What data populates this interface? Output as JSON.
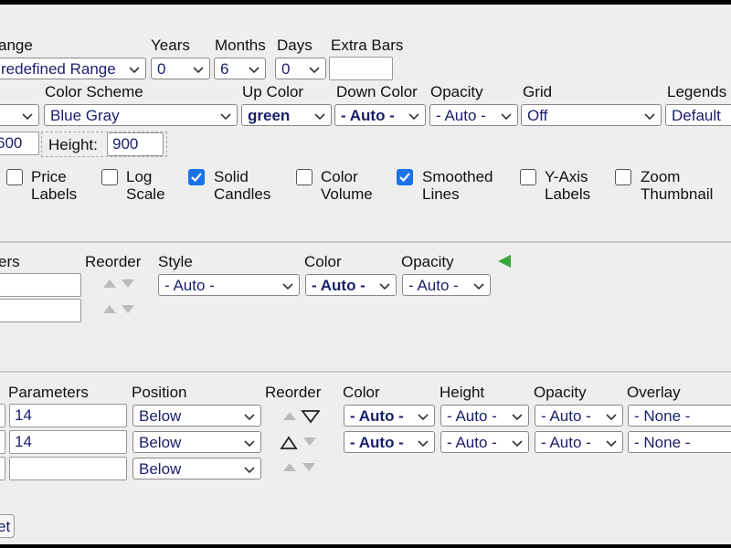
{
  "range": {
    "label_range": "ange",
    "label_years": "Years",
    "label_months": "Months",
    "label_days": "Days",
    "label_extra_bars": "Extra Bars",
    "range_value": "redefined Range",
    "years_value": "0",
    "months_value": "6",
    "days_value": "0",
    "extra_bars_value": ""
  },
  "appearance": {
    "label_color_scheme": "Color Scheme",
    "label_up_color": "Up Color",
    "label_down_color": "Down Color",
    "label_opacity": "Opacity",
    "label_grid": "Grid",
    "label_legends": "Legends",
    "color_scheme_value": "Blue Gray",
    "up_color_value": "green",
    "down_color_value": "- Auto -",
    "opacity_value": "- Auto -",
    "grid_value": "Off",
    "legends_value": "Default",
    "width_value": "600",
    "label_height": "Height:",
    "height_value": "900"
  },
  "options": [
    {
      "label": "Price\nLabels",
      "checked": false
    },
    {
      "label": "Log\nScale",
      "checked": false
    },
    {
      "label": "Solid\nCandles",
      "checked": true
    },
    {
      "label": "Color\nVolume",
      "checked": false
    },
    {
      "label": "Smoothed\nLines",
      "checked": true
    },
    {
      "label": "Y-Axis\nLabels",
      "checked": false
    },
    {
      "label": "Zoom\nThumbnail",
      "checked": false
    }
  ],
  "overlays": {
    "label_parameters": "ers",
    "label_reorder": "Reorder",
    "label_style": "Style",
    "label_color": "Color",
    "label_opacity": "Opacity",
    "style_value": "- Auto -",
    "color_value": "- Auto -",
    "opacity_value": "- Auto -",
    "param1": "",
    "param2": ""
  },
  "indicators": {
    "label_parameters": "Parameters",
    "label_position": "Position",
    "label_reorder": "Reorder",
    "label_color": "Color",
    "label_height": "Height",
    "label_opacity": "Opacity",
    "label_overlay": "Overlay",
    "rows": [
      {
        "param": "14",
        "position": "Below",
        "color": "- Auto -",
        "height": "- Auto -",
        "opacity": "- Auto -",
        "overlay": "- None -"
      },
      {
        "param": "14",
        "position": "Below",
        "color": "- Auto -",
        "height": "- Auto -",
        "opacity": "- Auto -",
        "overlay": "- None -"
      },
      {
        "param": "",
        "position": "Below"
      }
    ]
  },
  "footer": {
    "reset_label": "et"
  },
  "colors": {
    "background": "#eeeeee",
    "select_text": "#1a1f6a",
    "checkbox_checked": "#1a73e8",
    "arrow_green": "#3aa63a"
  }
}
